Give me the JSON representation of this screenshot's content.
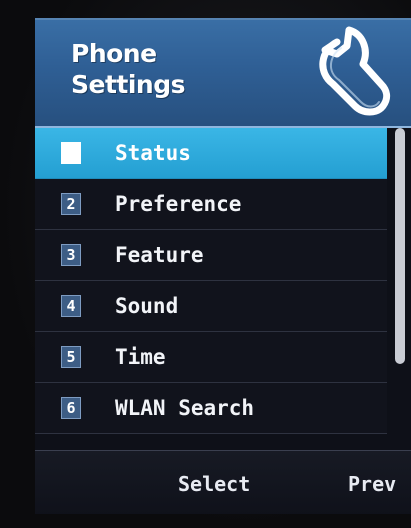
{
  "header": {
    "title_line1": "Phone",
    "title_line2": "Settings",
    "icon": "wrench-icon"
  },
  "menu": {
    "selected_index": 0,
    "items": [
      {
        "number": "1",
        "label": "Status"
      },
      {
        "number": "2",
        "label": "Preference"
      },
      {
        "number": "3",
        "label": "Feature"
      },
      {
        "number": "4",
        "label": "Sound"
      },
      {
        "number": "5",
        "label": "Time"
      },
      {
        "number": "6",
        "label": "WLAN Search"
      }
    ]
  },
  "softkeys": {
    "center": "Select",
    "right": "Prev"
  },
  "colors": {
    "header_blue": "#2f5f95",
    "selection_cyan": "#249fd2",
    "list_background": "#11131c"
  }
}
